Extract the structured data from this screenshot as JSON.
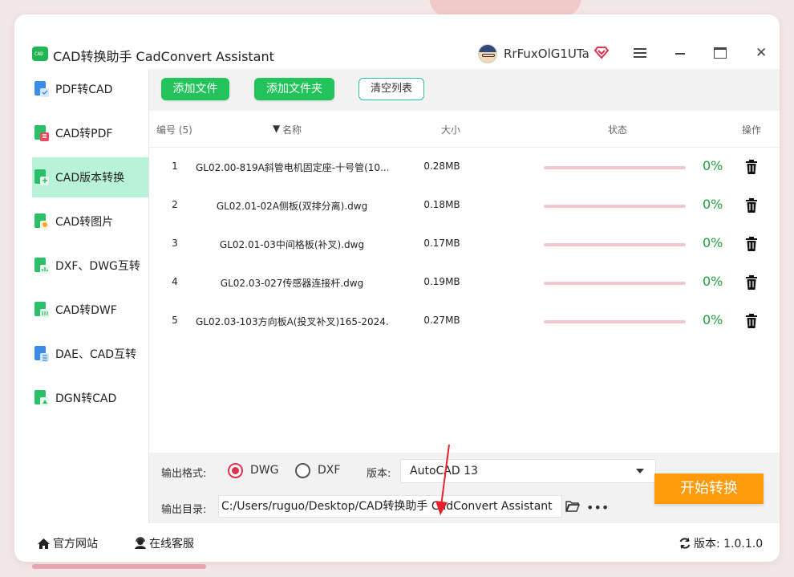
{
  "app": {
    "title": "CAD转换助手 CadConvert Assistant",
    "logo_text": "CAD",
    "user_name": "RrFuxOlG1UTa"
  },
  "sidebar": {
    "items": [
      {
        "label": "PDF转CAD",
        "active": false
      },
      {
        "label": "CAD转PDF",
        "active": false
      },
      {
        "label": "CAD版本转换",
        "active": true
      },
      {
        "label": "CAD转图片",
        "active": false
      },
      {
        "label": "DXF、DWG互转",
        "active": false
      },
      {
        "label": "CAD转DWF",
        "active": false
      },
      {
        "label": "DAE、CAD互转",
        "active": false
      },
      {
        "label": "DGN转CAD",
        "active": false
      }
    ]
  },
  "toolbar": {
    "add_file": "添加文件",
    "add_folder": "添加文件夹",
    "clear_list": "清空列表"
  },
  "table": {
    "headers": {
      "index": "编号 (5)",
      "name": "名称",
      "size": "大小",
      "status": "状态",
      "action": "操作"
    },
    "rows": [
      {
        "index": "1",
        "name": "GL02.00-819A斜管电机固定座-十号管(10...",
        "size": "0.28MB",
        "progress": 0,
        "percent": "0%"
      },
      {
        "index": "2",
        "name": "GL02.01-02A侧板(双排分离).dwg",
        "size": "0.18MB",
        "progress": 0,
        "percent": "0%"
      },
      {
        "index": "3",
        "name": "GL02.01-03中间格板(补叉).dwg",
        "size": "0.17MB",
        "progress": 0,
        "percent": "0%"
      },
      {
        "index": "4",
        "name": "GL02.03-027传感器连接杆.dwg",
        "size": "0.19MB",
        "progress": 0,
        "percent": "0%"
      },
      {
        "index": "5",
        "name": "GL02.03-103方向板A(投叉补叉)165-2024...",
        "size": "0.27MB",
        "progress": 0,
        "percent": "0%"
      }
    ]
  },
  "output": {
    "format_label": "输出格式:",
    "formats": [
      {
        "label": "DWG",
        "checked": true
      },
      {
        "label": "DXF",
        "checked": false
      }
    ],
    "version_label": "版本:",
    "version_value": "AutoCAD 13",
    "dir_label": "输出目录:",
    "dir_value": "C:/Users/ruguo/Desktop/CAD转换助手 CadConvert Assistant",
    "more": "•••",
    "start_button": "开始转换"
  },
  "footer": {
    "website": "官方网站",
    "support": "在线客服",
    "version": "版本: 1.0.1.0"
  },
  "colors": {
    "accent_green": "#22c35a",
    "active_sidebar": "#b8f2d8",
    "start_orange": "#ff9a0a",
    "radio_red": "#e0304f",
    "percent_green": "#1f9e3c"
  }
}
